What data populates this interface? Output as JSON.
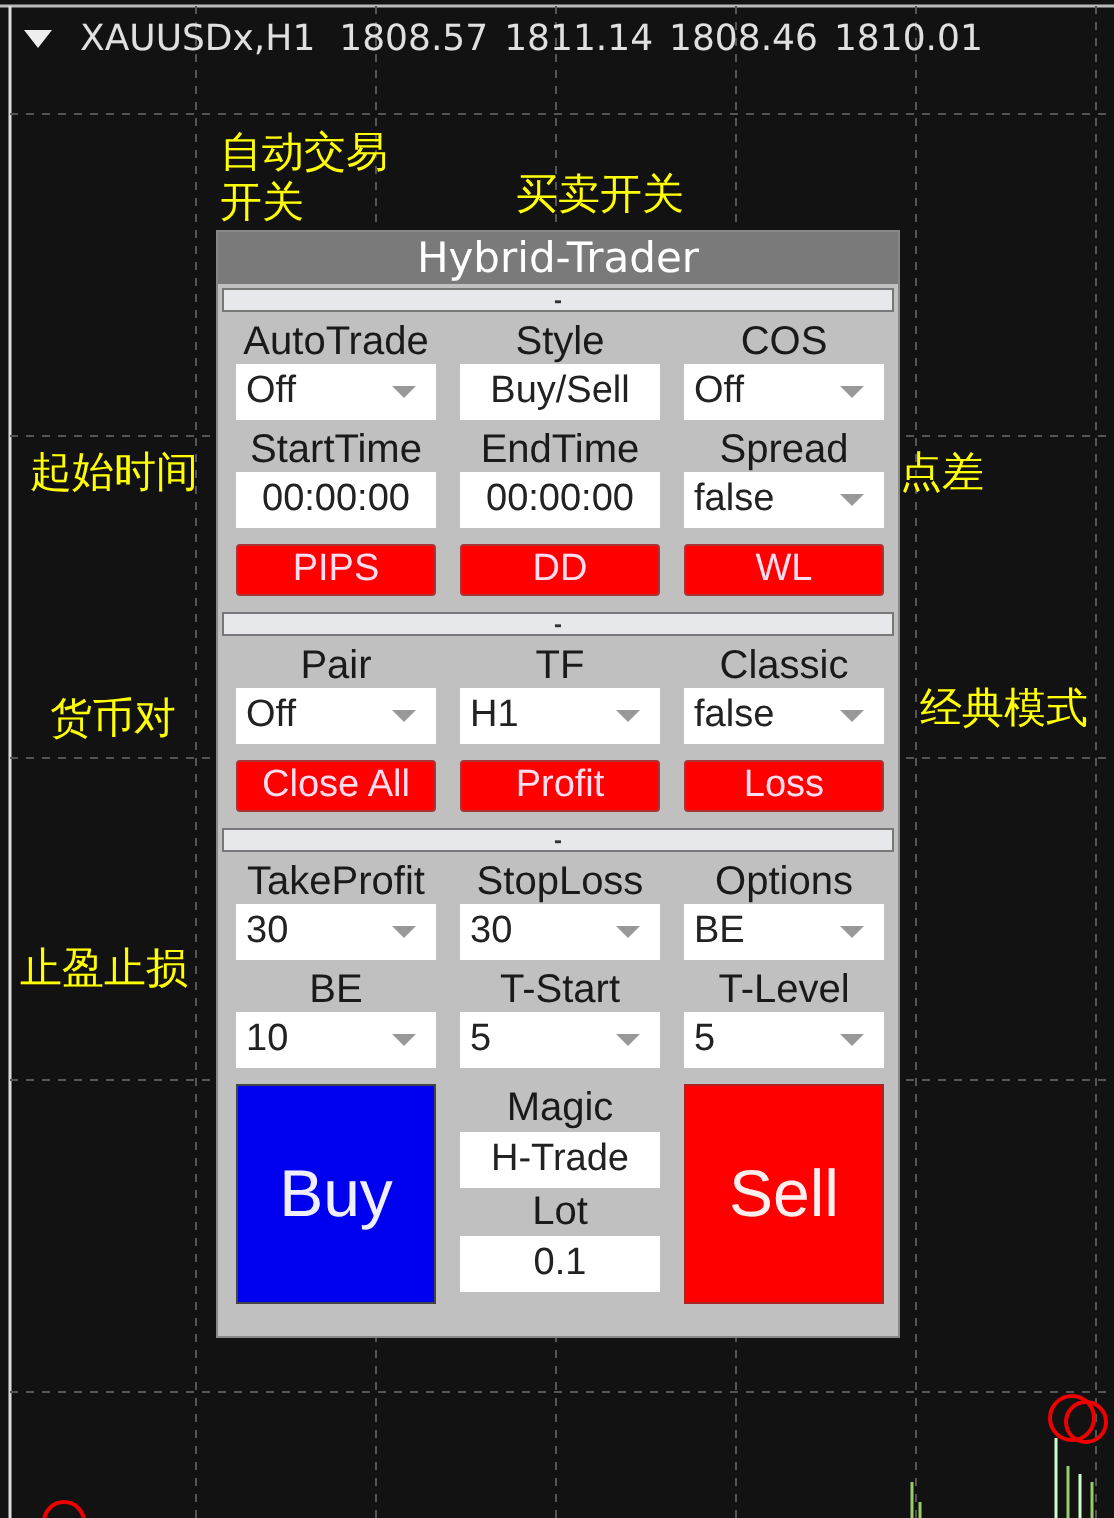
{
  "chart_header": {
    "symbol": "XAUUSDx,H1",
    "prices": [
      "1808.57",
      "1811.14",
      "1808.46",
      "1810.01"
    ]
  },
  "annotations": [
    "自动交易开关",
    "买卖开关",
    "起始时间",
    "点差",
    "货币对",
    "经典模式",
    "止盈止损"
  ],
  "panel": {
    "title": "Hybrid-Trader",
    "sections": [
      {
        "toggle": "-",
        "rows": [
          {
            "kind": "fields",
            "cells": [
              {
                "label": "AutoTrade",
                "value": "Off",
                "kind": "dropdown"
              },
              {
                "label": "Style",
                "value": "Buy/Sell",
                "kind": "text"
              },
              {
                "label": "COS",
                "value": "Off",
                "kind": "dropdown"
              }
            ]
          },
          {
            "kind": "fields",
            "cells": [
              {
                "label": "StartTime",
                "value": "00:00:00",
                "kind": "text"
              },
              {
                "label": "EndTime",
                "value": "00:00:00",
                "kind": "text"
              },
              {
                "label": "Spread",
                "value": "false",
                "kind": "dropdown"
              }
            ]
          },
          {
            "kind": "buttons",
            "buttons": [
              "PIPS",
              "DD",
              "WL"
            ]
          }
        ]
      },
      {
        "toggle": "-",
        "rows": [
          {
            "kind": "fields",
            "cells": [
              {
                "label": "Pair",
                "value": "Off",
                "kind": "dropdown"
              },
              {
                "label": "TF",
                "value": "H1",
                "kind": "dropdown"
              },
              {
                "label": "Classic",
                "value": "false",
                "kind": "dropdown"
              }
            ]
          },
          {
            "kind": "buttons",
            "buttons": [
              "Close All",
              "Profit",
              "Loss"
            ]
          }
        ]
      },
      {
        "toggle": "-",
        "rows": [
          {
            "kind": "fields",
            "cells": [
              {
                "label": "TakeProfit",
                "value": "30",
                "kind": "dropdown"
              },
              {
                "label": "StopLoss",
                "value": "30",
                "kind": "dropdown"
              },
              {
                "label": "Options",
                "value": "BE",
                "kind": "dropdown"
              }
            ]
          },
          {
            "kind": "fields",
            "cells": [
              {
                "label": "BE",
                "value": "10",
                "kind": "dropdown"
              },
              {
                "label": "T-Start",
                "value": "5",
                "kind": "dropdown"
              },
              {
                "label": "T-Level",
                "value": "5",
                "kind": "dropdown"
              }
            ]
          },
          {
            "kind": "trade",
            "buy": "Buy",
            "magic_label": "Magic",
            "magic": "H-Trade",
            "lot_label": "Lot",
            "lot": "0.1",
            "sell": "Sell"
          }
        ]
      }
    ]
  }
}
